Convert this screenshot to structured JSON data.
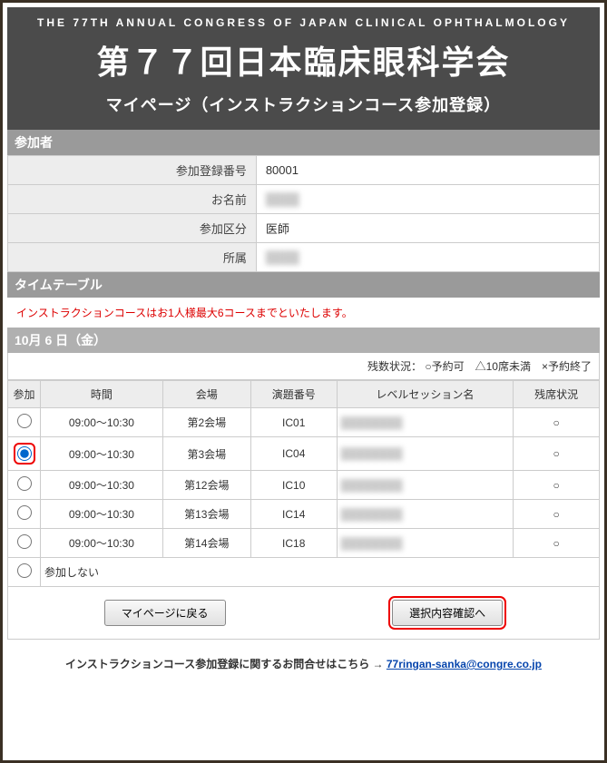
{
  "header": {
    "small": "THE 77TH ANNUAL CONGRESS OF JAPAN CLINICAL OPHTHALMOLOGY",
    "title": "第７７回日本臨床眼科学会",
    "sub": "マイページ（インストラクションコース参加登録）"
  },
  "section_participant": "参加者",
  "profile": {
    "reg_no_lbl": "参加登録番号",
    "reg_no": "80001",
    "name_lbl": "お名前",
    "name": "████",
    "cat_lbl": "参加区分",
    "cat": "医師",
    "aff_lbl": "所属",
    "aff": "████"
  },
  "section_timetable": "タイムテーブル",
  "notice": "インストラクションコースはお1人様最大6コースまでといたします。",
  "date_title": "10月 6 日（金）",
  "legend": "残数状況： ○予約可　△10席未満　×予約終了",
  "cols": {
    "c1": "参加",
    "c2": "時間",
    "c3": "会場",
    "c4": "演題番号",
    "c5": "レベルセッション名",
    "c6": "残席状況"
  },
  "rows": [
    {
      "time": "09:00～10:30",
      "room": "第2会場",
      "code": "IC01",
      "session": "████████",
      "seat": "○",
      "selected": false
    },
    {
      "time": "09:00～10:30",
      "room": "第3会場",
      "code": "IC04",
      "session": "████████",
      "seat": "○",
      "selected": true
    },
    {
      "time": "09:00～10:30",
      "room": "第12会場",
      "code": "IC10",
      "session": "████████",
      "seat": "○",
      "selected": false
    },
    {
      "time": "09:00～10:30",
      "room": "第13会場",
      "code": "IC14",
      "session": "████████",
      "seat": "○",
      "selected": false
    },
    {
      "time": "09:00～10:30",
      "room": "第14会場",
      "code": "IC18",
      "session": "████████",
      "seat": "○",
      "selected": false
    }
  ],
  "none_label": "参加しない",
  "btn_back": "マイページに戻る",
  "btn_next": "選択内容確認へ",
  "footer_text": "インストラクションコース参加登録に関するお問合せはこちら → ",
  "footer_link": "77ringan-sanka@congre.co.jp"
}
